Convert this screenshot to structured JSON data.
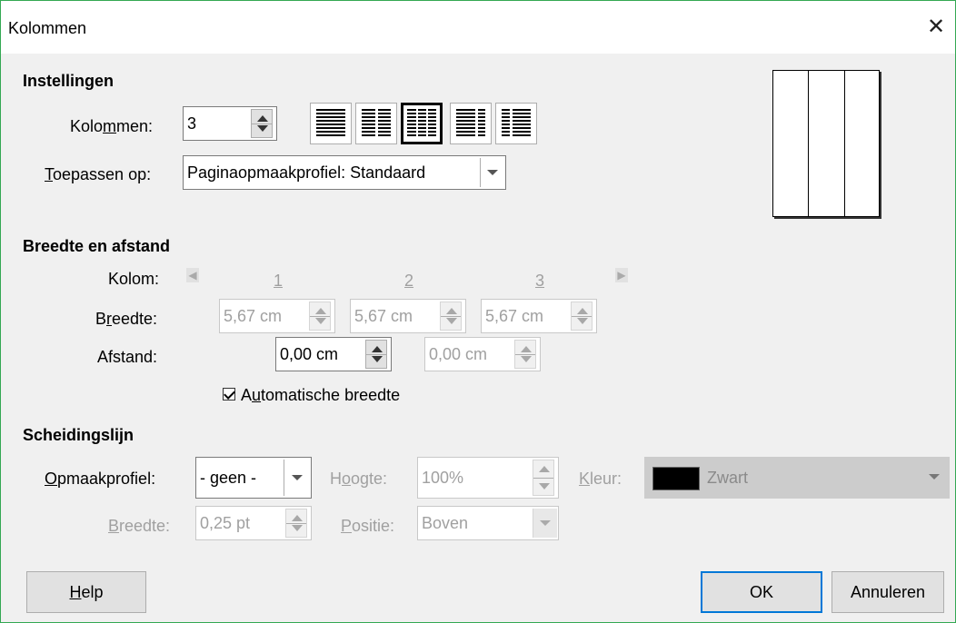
{
  "window": {
    "title": "Kolommen",
    "close_glyph": "✕"
  },
  "instellingen": {
    "heading": "Instellingen",
    "kolommen_label": "Kolommen:",
    "kolommen_value": "3",
    "layout_buttons": [
      "1-column",
      "2-columns",
      "3-columns",
      "left-wide",
      "right-wide"
    ],
    "selected_layout": 2,
    "toepassen_label": "Toepassen op:",
    "toepassen_value": "Paginaopmaakprofiel: Standaard"
  },
  "breedte_afstand": {
    "heading": "Breedte en afstand",
    "kolom_label": "Kolom:",
    "kolom_numbers": [
      "1",
      "2",
      "3"
    ],
    "breedte_label": "Breedte:",
    "breedte_values": [
      "5,67 cm",
      "5,67 cm",
      "5,67 cm"
    ],
    "afstand_label": "Afstand:",
    "afstand_values": [
      "0,00 cm",
      "0,00 cm"
    ],
    "auto_label": "Automatische breedte",
    "auto_checked": true
  },
  "scheidingslijn": {
    "heading": "Scheidingslijn",
    "opmaakprofiel_label": "Opmaakprofiel:",
    "opmaakprofiel_value": "- geen -",
    "hoogte_label": "Hoogte:",
    "hoogte_value": "100%",
    "kleur_label": "Kleur:",
    "kleur_value": "Zwart",
    "kleur_swatch": "#000000",
    "breedte_label": "Breedte:",
    "breedte_value": "0,25 pt",
    "positie_label": "Positie:",
    "positie_value": "Boven"
  },
  "buttons": {
    "help": "Help",
    "ok": "OK",
    "cancel": "Annuleren"
  },
  "colors": {
    "accent": "#0078d7",
    "window_border": "#34a853"
  }
}
